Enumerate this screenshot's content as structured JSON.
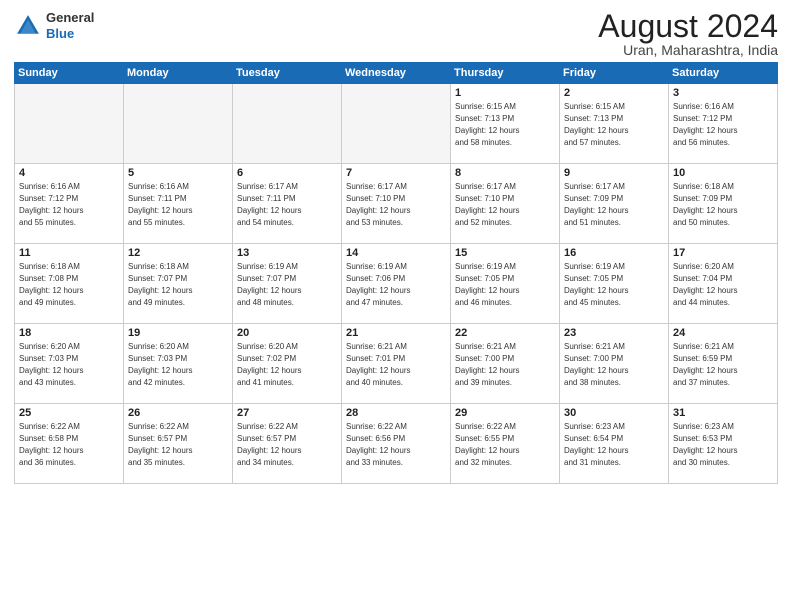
{
  "header": {
    "logo_general": "General",
    "logo_blue": "Blue",
    "month_title": "August 2024",
    "subtitle": "Uran, Maharashtra, India"
  },
  "days_of_week": [
    "Sunday",
    "Monday",
    "Tuesday",
    "Wednesday",
    "Thursday",
    "Friday",
    "Saturday"
  ],
  "weeks": [
    [
      {
        "day": "",
        "info": ""
      },
      {
        "day": "",
        "info": ""
      },
      {
        "day": "",
        "info": ""
      },
      {
        "day": "",
        "info": ""
      },
      {
        "day": "1",
        "info": "Sunrise: 6:15 AM\nSunset: 7:13 PM\nDaylight: 12 hours\nand 58 minutes."
      },
      {
        "day": "2",
        "info": "Sunrise: 6:15 AM\nSunset: 7:13 PM\nDaylight: 12 hours\nand 57 minutes."
      },
      {
        "day": "3",
        "info": "Sunrise: 6:16 AM\nSunset: 7:12 PM\nDaylight: 12 hours\nand 56 minutes."
      }
    ],
    [
      {
        "day": "4",
        "info": "Sunrise: 6:16 AM\nSunset: 7:12 PM\nDaylight: 12 hours\nand 55 minutes."
      },
      {
        "day": "5",
        "info": "Sunrise: 6:16 AM\nSunset: 7:11 PM\nDaylight: 12 hours\nand 55 minutes."
      },
      {
        "day": "6",
        "info": "Sunrise: 6:17 AM\nSunset: 7:11 PM\nDaylight: 12 hours\nand 54 minutes."
      },
      {
        "day": "7",
        "info": "Sunrise: 6:17 AM\nSunset: 7:10 PM\nDaylight: 12 hours\nand 53 minutes."
      },
      {
        "day": "8",
        "info": "Sunrise: 6:17 AM\nSunset: 7:10 PM\nDaylight: 12 hours\nand 52 minutes."
      },
      {
        "day": "9",
        "info": "Sunrise: 6:17 AM\nSunset: 7:09 PM\nDaylight: 12 hours\nand 51 minutes."
      },
      {
        "day": "10",
        "info": "Sunrise: 6:18 AM\nSunset: 7:09 PM\nDaylight: 12 hours\nand 50 minutes."
      }
    ],
    [
      {
        "day": "11",
        "info": "Sunrise: 6:18 AM\nSunset: 7:08 PM\nDaylight: 12 hours\nand 49 minutes."
      },
      {
        "day": "12",
        "info": "Sunrise: 6:18 AM\nSunset: 7:07 PM\nDaylight: 12 hours\nand 49 minutes."
      },
      {
        "day": "13",
        "info": "Sunrise: 6:19 AM\nSunset: 7:07 PM\nDaylight: 12 hours\nand 48 minutes."
      },
      {
        "day": "14",
        "info": "Sunrise: 6:19 AM\nSunset: 7:06 PM\nDaylight: 12 hours\nand 47 minutes."
      },
      {
        "day": "15",
        "info": "Sunrise: 6:19 AM\nSunset: 7:05 PM\nDaylight: 12 hours\nand 46 minutes."
      },
      {
        "day": "16",
        "info": "Sunrise: 6:19 AM\nSunset: 7:05 PM\nDaylight: 12 hours\nand 45 minutes."
      },
      {
        "day": "17",
        "info": "Sunrise: 6:20 AM\nSunset: 7:04 PM\nDaylight: 12 hours\nand 44 minutes."
      }
    ],
    [
      {
        "day": "18",
        "info": "Sunrise: 6:20 AM\nSunset: 7:03 PM\nDaylight: 12 hours\nand 43 minutes."
      },
      {
        "day": "19",
        "info": "Sunrise: 6:20 AM\nSunset: 7:03 PM\nDaylight: 12 hours\nand 42 minutes."
      },
      {
        "day": "20",
        "info": "Sunrise: 6:20 AM\nSunset: 7:02 PM\nDaylight: 12 hours\nand 41 minutes."
      },
      {
        "day": "21",
        "info": "Sunrise: 6:21 AM\nSunset: 7:01 PM\nDaylight: 12 hours\nand 40 minutes."
      },
      {
        "day": "22",
        "info": "Sunrise: 6:21 AM\nSunset: 7:00 PM\nDaylight: 12 hours\nand 39 minutes."
      },
      {
        "day": "23",
        "info": "Sunrise: 6:21 AM\nSunset: 7:00 PM\nDaylight: 12 hours\nand 38 minutes."
      },
      {
        "day": "24",
        "info": "Sunrise: 6:21 AM\nSunset: 6:59 PM\nDaylight: 12 hours\nand 37 minutes."
      }
    ],
    [
      {
        "day": "25",
        "info": "Sunrise: 6:22 AM\nSunset: 6:58 PM\nDaylight: 12 hours\nand 36 minutes."
      },
      {
        "day": "26",
        "info": "Sunrise: 6:22 AM\nSunset: 6:57 PM\nDaylight: 12 hours\nand 35 minutes."
      },
      {
        "day": "27",
        "info": "Sunrise: 6:22 AM\nSunset: 6:57 PM\nDaylight: 12 hours\nand 34 minutes."
      },
      {
        "day": "28",
        "info": "Sunrise: 6:22 AM\nSunset: 6:56 PM\nDaylight: 12 hours\nand 33 minutes."
      },
      {
        "day": "29",
        "info": "Sunrise: 6:22 AM\nSunset: 6:55 PM\nDaylight: 12 hours\nand 32 minutes."
      },
      {
        "day": "30",
        "info": "Sunrise: 6:23 AM\nSunset: 6:54 PM\nDaylight: 12 hours\nand 31 minutes."
      },
      {
        "day": "31",
        "info": "Sunrise: 6:23 AM\nSunset: 6:53 PM\nDaylight: 12 hours\nand 30 minutes."
      }
    ]
  ]
}
